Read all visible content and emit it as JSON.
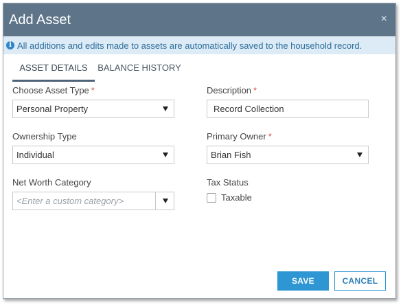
{
  "dialog": {
    "title": "Add Asset",
    "close_glyph": "×",
    "info_icon": "i",
    "info_text": "All additions and edits made to assets are automatically saved to the household record."
  },
  "tabs": [
    {
      "label": "ASSET DETAILS",
      "active": true
    },
    {
      "label": "BALANCE HISTORY",
      "active": false
    }
  ],
  "form": {
    "asset_type": {
      "label": "Choose Asset Type",
      "required_mark": "*",
      "value": "Personal Property"
    },
    "description": {
      "label": "Description",
      "required_mark": "*",
      "value": "Record Collection"
    },
    "ownership_type": {
      "label": "Ownership Type",
      "value": "Individual"
    },
    "primary_owner": {
      "label": "Primary Owner",
      "required_mark": "*",
      "value": "Brian Fish"
    },
    "net_worth_category": {
      "label": "Net Worth Category",
      "placeholder": "<Enter a custom category>"
    },
    "tax_status": {
      "label": "Tax Status",
      "checkbox_label": "Taxable",
      "checked": false
    }
  },
  "buttons": {
    "save": "SAVE",
    "cancel": "CANCEL"
  },
  "colors": {
    "titlebar": "#5d7489",
    "info_bg": "#dcebf6",
    "accent": "#2d96d3",
    "required": "#d9534f"
  }
}
